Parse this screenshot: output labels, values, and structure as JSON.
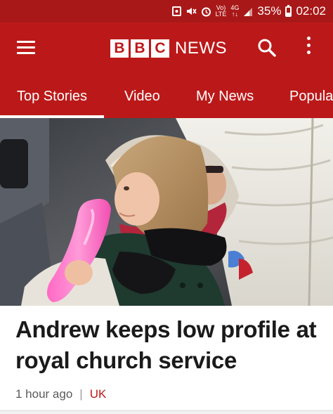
{
  "status_bar": {
    "battery_percent": "35%",
    "time": "02:02",
    "volte_top": "Vo)",
    "volte_bottom": "LTE",
    "network_top": "4G",
    "network_bottom": "↑↓",
    "battery_level": 0.35,
    "icons": [
      "image-icon",
      "mute-icon",
      "alarm-icon",
      "volte-icon",
      "network-4g-icon",
      "signal-icon",
      "battery-icon"
    ]
  },
  "app_bar": {
    "logo_letters": [
      "B",
      "B",
      "C"
    ],
    "logo_word": "NEWS",
    "icons": [
      "menu-icon",
      "search-icon",
      "more-vert-icon"
    ]
  },
  "tabs": [
    {
      "label": "Top Stories",
      "active": true
    },
    {
      "label": "Video",
      "active": false
    },
    {
      "label": "My News",
      "active": false
    },
    {
      "label": "Popula",
      "active": false
    }
  ],
  "story": {
    "headline": "Andrew keeps low profile at royal church service",
    "time_ago": "1 hour ago",
    "separator": "|",
    "category": "UK"
  },
  "colors": {
    "status_bar": "#a91818",
    "brand_red": "#bb1919",
    "headline": "#1a1a1a",
    "meta": "#5a5a5a"
  }
}
